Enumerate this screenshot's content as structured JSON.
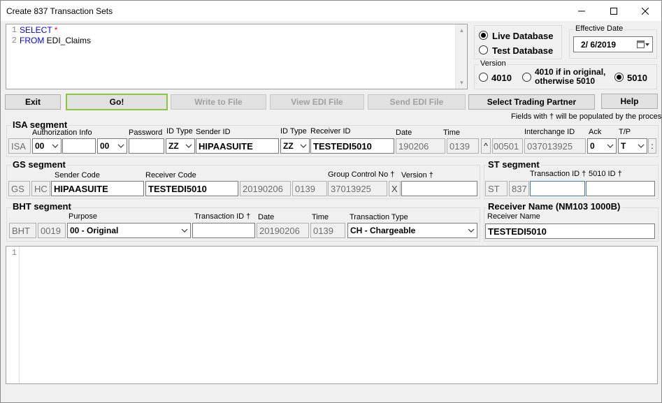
{
  "window": {
    "title": "Create 837 Transaction Sets",
    "minimize": "—",
    "maximize": "☐",
    "close": "✕"
  },
  "query": {
    "line_numbers": [
      "1",
      "2"
    ],
    "lines": [
      {
        "kw": "SELECT",
        "rest": " *"
      },
      {
        "kw": "FROM",
        "rest": " EDI_Claims"
      }
    ]
  },
  "database": {
    "options": [
      {
        "label": "Live Database",
        "selected": true
      },
      {
        "label": "Test Database",
        "selected": false
      }
    ]
  },
  "effective_date": {
    "label": "Effective Date",
    "value": "2/  6/2019"
  },
  "version": {
    "label": "Version",
    "options": [
      {
        "label": "4010",
        "selected": false
      },
      {
        "label": "4010 if in original,",
        "label2": "otherwise 5010",
        "selected": false
      },
      {
        "label": "5010",
        "selected": true
      }
    ]
  },
  "buttons": {
    "exit": "Exit",
    "go": "Go!",
    "write_file": "Write to File",
    "view_edi": "View EDI File",
    "send_edi": "Send EDI File",
    "select_partner": "Select Trading Partner",
    "help": "Help"
  },
  "note": "Fields with † will be populated by the process.",
  "isa": {
    "title": "ISA segment",
    "labels": {
      "auth": "Authorization Info",
      "password": "Password",
      "id_type": "ID Type",
      "sender_id": "Sender ID",
      "id_type2": "ID Type",
      "receiver_id": "Receiver ID",
      "date": "Date",
      "time": "Time",
      "interchange_id": "Interchange ID",
      "ack": "Ack",
      "tp": "T/P"
    },
    "seg": "ISA",
    "auth_qual": "00",
    "auth_info": "",
    "pw_qual": "00",
    "password": "",
    "sender_qual": "ZZ",
    "sender_id": "HIPAASUITE",
    "receiver_qual": "ZZ",
    "receiver_id": "TESTEDI5010",
    "date": "190206",
    "time": "0139",
    "caret": "^",
    "version": "00501",
    "interchange_id": "037013925",
    "ack": "0",
    "tp": "T",
    "sep": ":"
  },
  "gs": {
    "title": "GS segment",
    "labels": {
      "sender": "Sender Code",
      "receiver": "Receiver Code",
      "group_ctrl": "Group Control No †",
      "version": "Version †"
    },
    "seg": "GS",
    "func": "HC",
    "sender": "HIPAASUITE",
    "receiver": "TESTEDI5010",
    "date": "20190206",
    "time": "0139",
    "group_ctrl": "37013925",
    "x": "X",
    "version": ""
  },
  "st": {
    "title": "ST segment",
    "labels": {
      "txn_id": "Transaction ID †",
      "id5010": "5010 ID †"
    },
    "seg": "ST",
    "code": "837",
    "txn_id": "",
    "id5010": ""
  },
  "bht": {
    "title": "BHT segment",
    "labels": {
      "purpose": "Purpose",
      "txn_id": "Transaction ID †",
      "date": "Date",
      "time": "Time",
      "txn_type": "Transaction Type"
    },
    "seg": "BHT",
    "code": "0019",
    "purpose": "00 - Original",
    "txn_id": "",
    "date": "20190206",
    "time": "0139",
    "txn_type": "CH - Chargeable"
  },
  "receiver": {
    "title": "Receiver Name (NM103 1000B)",
    "label": "Receiver Name",
    "value": "TESTEDI5010"
  },
  "output": {
    "line_numbers": [
      "1"
    ]
  }
}
